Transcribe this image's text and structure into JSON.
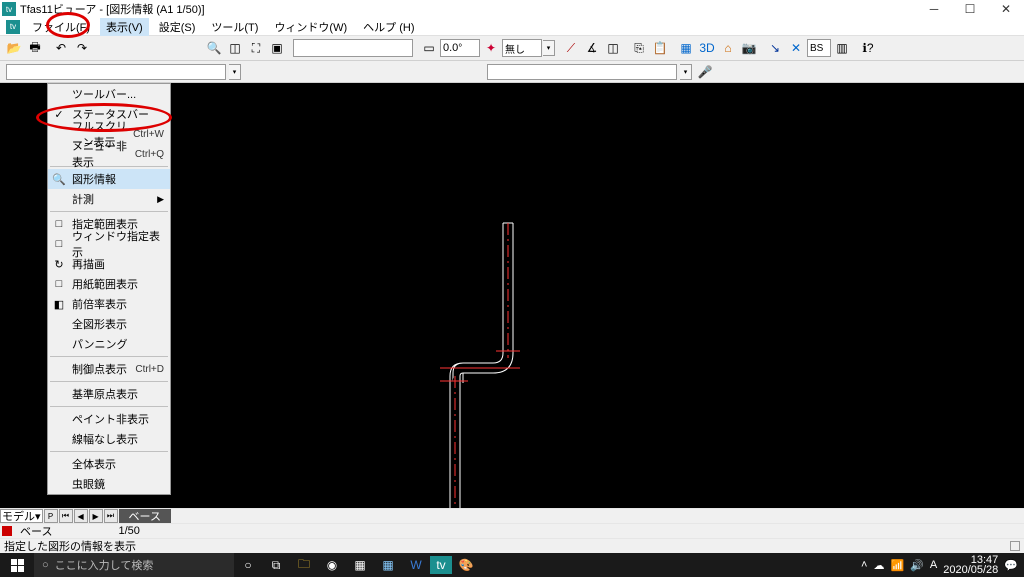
{
  "title": "Tfas11ビューア - [図形情報 (A1 1/50)]",
  "menubar": [
    "ファイル(F)",
    "表示(V)",
    "設定(S)",
    "ツール(T)",
    "ウィンドウ(W)",
    "ヘルプ (H)"
  ],
  "combo_angle": "0.0",
  "combo_none": "無し",
  "combo_bs": "BS",
  "dropdown": {
    "items": [
      {
        "label": "ツールバー...",
        "icon": "",
        "sc": "",
        "arrow": false
      },
      {
        "label": "ステータスバー",
        "icon": "✓",
        "sc": "",
        "arrow": false
      },
      {
        "label": "フルスクリーン表示",
        "icon": "",
        "sc": "Ctrl+W",
        "arrow": false
      },
      {
        "label": "メニュー非表示",
        "icon": "",
        "sc": "Ctrl+Q",
        "arrow": false
      },
      {
        "sep": true
      },
      {
        "label": "図形情報",
        "icon": "🔍",
        "sc": "",
        "arrow": false,
        "hl": true
      },
      {
        "label": "計測",
        "icon": "",
        "sc": "",
        "arrow": true
      },
      {
        "sep": true
      },
      {
        "label": "指定範囲表示",
        "icon": "□",
        "sc": "",
        "arrow": false
      },
      {
        "label": "ウィンドウ指定表示",
        "icon": "□",
        "sc": "",
        "arrow": false
      },
      {
        "label": "再描画",
        "icon": "↻",
        "sc": "",
        "arrow": false
      },
      {
        "label": "用紙範囲表示",
        "icon": "□",
        "sc": "",
        "arrow": false
      },
      {
        "label": "前倍率表示",
        "icon": "◧",
        "sc": "",
        "arrow": false
      },
      {
        "label": "全図形表示",
        "icon": "",
        "sc": "",
        "arrow": false
      },
      {
        "label": "パンニング",
        "icon": "",
        "sc": "",
        "arrow": false
      },
      {
        "sep": true
      },
      {
        "label": "制御点表示",
        "icon": "",
        "sc": "Ctrl+D",
        "arrow": false
      },
      {
        "sep": true
      },
      {
        "label": "基準原点表示",
        "icon": "",
        "sc": "",
        "arrow": false
      },
      {
        "sep": true
      },
      {
        "label": "ペイント非表示",
        "icon": "",
        "sc": "",
        "arrow": false
      },
      {
        "label": "線幅なし表示",
        "icon": "",
        "sc": "",
        "arrow": false
      },
      {
        "sep": true
      },
      {
        "label": "全体表示",
        "icon": "",
        "sc": "",
        "arrow": false
      },
      {
        "label": "虫眼鏡",
        "icon": "",
        "sc": "",
        "arrow": false
      }
    ]
  },
  "bottom": {
    "model": "モデル",
    "P": "P",
    "tab": "ベース",
    "scale": "1/50"
  },
  "status": {
    "msg": "指定した図形の情報を表示"
  },
  "taskbar": {
    "search_placeholder": "ここに入力して検索",
    "time": "13:47",
    "date": "2020/05/28",
    "lang": "A"
  }
}
